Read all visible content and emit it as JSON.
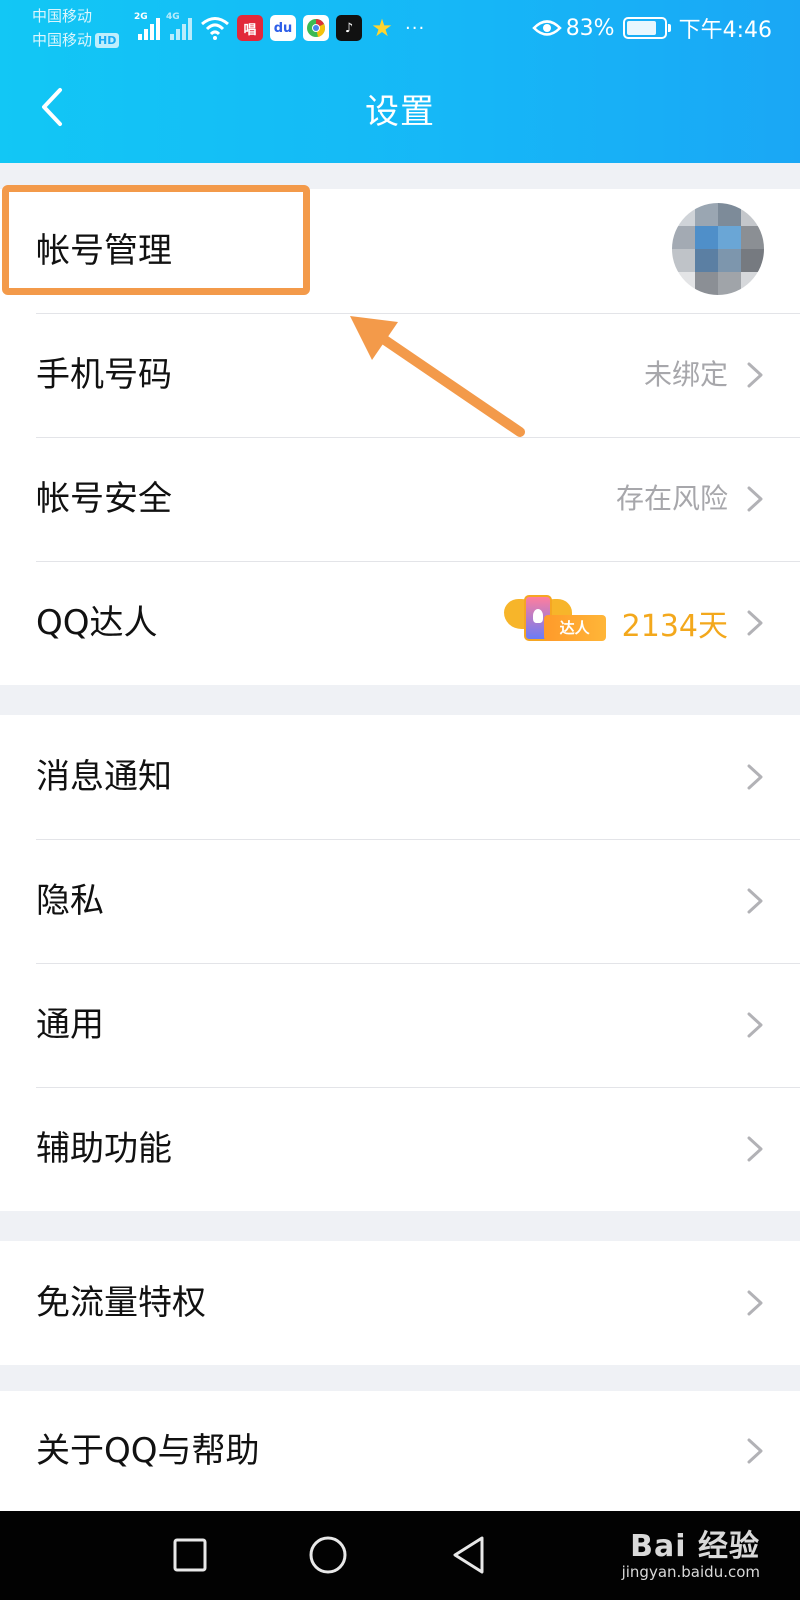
{
  "status_bar": {
    "carrier_1": "中国移动",
    "carrier_2": "中国移动",
    "hd_badge": "HD",
    "net_1": "2G",
    "net_2": "4G",
    "app_icons": [
      "signal-2g-icon",
      "signal-4g-icon",
      "wifi-icon",
      "netease-music-icon",
      "baidu-icon",
      "chrome-icon",
      "tiktok-icon",
      "star-game-icon"
    ],
    "more": "···",
    "battery_level": 0.83,
    "battery": "83%",
    "time": "下午4:46"
  },
  "title_bar": {
    "back_icon": "chevron-left-icon",
    "title": "设置"
  },
  "groups": {
    "account": {
      "manage": {
        "label": "帐号管理"
      },
      "phone": {
        "label": "手机号码",
        "value": "未绑定"
      },
      "security": {
        "label": "帐号安全",
        "value": "存在风险"
      },
      "qq_daren": {
        "label": "QQ达人",
        "badge": "达人",
        "days": "2134天"
      }
    },
    "general": {
      "notify": {
        "label": "消息通知"
      },
      "privacy": {
        "label": "隐私"
      },
      "common": {
        "label": "通用"
      },
      "accessibility": {
        "label": "辅助功能"
      }
    },
    "traffic": {
      "free": {
        "label": "免流量特权"
      }
    },
    "about": {
      "help": {
        "label": "关于QQ与帮助"
      }
    }
  },
  "annotation": {
    "color": "#f39a4a"
  },
  "nav_bar": {
    "icons": [
      "recent-apps-icon",
      "home-icon",
      "back-triangle-icon"
    ],
    "watermark_main": "Bai 经验",
    "watermark_url": "jingyan.baidu.com"
  },
  "colors": {
    "header_start": "#12c7f5",
    "header_end": "#1aa7f5",
    "divider": "#e3e4e8",
    "secondary_text": "#a7a7ab",
    "days_orange": "#f3a81c",
    "background": "#eff1f5"
  }
}
